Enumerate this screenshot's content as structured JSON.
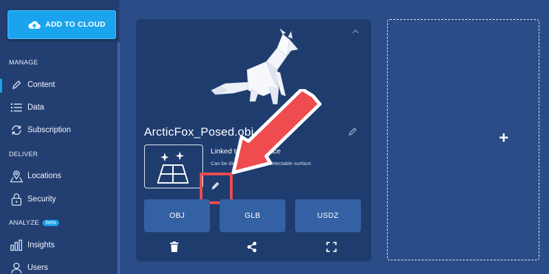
{
  "sidebar": {
    "add_to_cloud_label": "ADD TO CLOUD",
    "sections": {
      "manage": "MANAGE",
      "deliver": "DELIVER",
      "analyze": "ANALYZE",
      "analyze_badge": "beta"
    },
    "items": [
      {
        "label": "Content",
        "icon": "pencil-icon",
        "active": true
      },
      {
        "label": "Data",
        "icon": "list-icon"
      },
      {
        "label": "Subscription",
        "icon": "refresh-icon"
      },
      {
        "label": "Locations",
        "icon": "map-pin-icon"
      },
      {
        "label": "Security",
        "icon": "lock-icon"
      },
      {
        "label": "Insights",
        "icon": "bar-chart-icon"
      },
      {
        "label": "Users",
        "icon": "user-icon"
      }
    ]
  },
  "card": {
    "model_name": "ArcticFox_Posed.obj",
    "surface_title": "Linked to Any Surface",
    "surface_description": "Can be displayed on any detectable surface.",
    "formats": [
      "OBJ",
      "GLB",
      "USDZ"
    ],
    "actions": [
      "trash-icon",
      "share-icon",
      "fullscreen-icon"
    ]
  },
  "dropzone": {
    "plus_symbol": "+"
  },
  "colors": {
    "background": "#2a4d88",
    "sidebar": "#233f72",
    "card": "#1f3c6e",
    "accent": "#1aa4ee",
    "format_button": "#3461a3",
    "annotation_red": "#ef4c50"
  }
}
